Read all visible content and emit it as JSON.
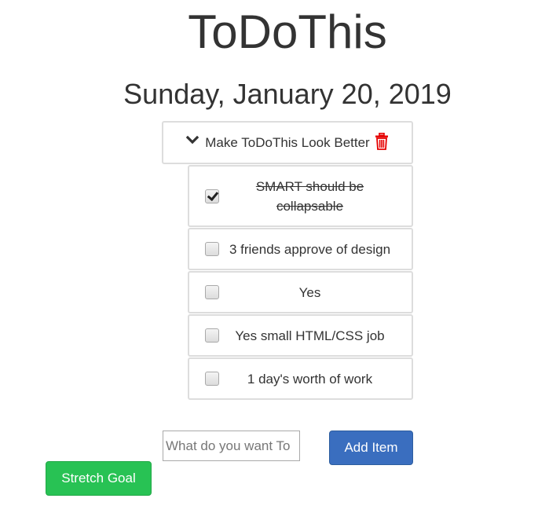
{
  "app": {
    "title": "ToDoThis"
  },
  "date_heading": "Sunday, January 20, 2019",
  "goal": {
    "label": "Make ToDoThis Look Better",
    "toggle_icon": "chevron-down-icon",
    "delete_icon": "trash-icon",
    "delete_color": "#e60000"
  },
  "tasks": [
    {
      "text": "SMART should be collapsable",
      "checked": true
    },
    {
      "text": "3 friends approve of design",
      "checked": false
    },
    {
      "text": "Yes",
      "checked": false
    },
    {
      "text": "Yes small HTML/CSS job",
      "checked": false
    },
    {
      "text": "1 day's worth of work",
      "checked": false
    }
  ],
  "new_item": {
    "placeholder": "What do you want To",
    "value": ""
  },
  "buttons": {
    "add_item": "Add Item",
    "stretch_goal": "Stretch Goal"
  },
  "colors": {
    "primary": "#3a6ebf",
    "success": "#28c254",
    "border": "#dddddd",
    "text": "#333333"
  }
}
